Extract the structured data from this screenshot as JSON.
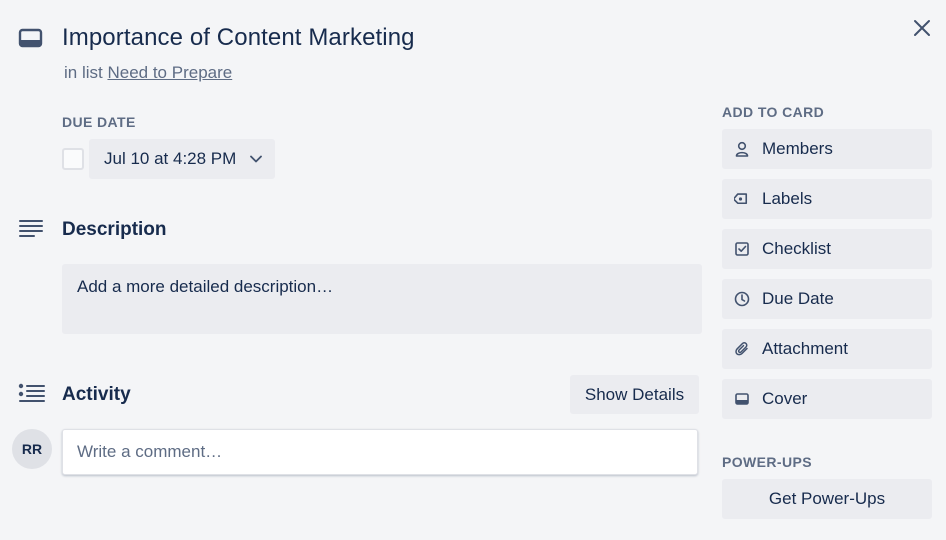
{
  "card": {
    "title": "Importance of Content Marketing",
    "list_prefix": "in list",
    "list_name": "Need to Prepare"
  },
  "due_date": {
    "label": "DUE DATE",
    "value": "Jul 10 at 4:28 PM",
    "checked": false
  },
  "description": {
    "heading": "Description",
    "placeholder": "Add a more detailed description…"
  },
  "activity": {
    "heading": "Activity",
    "show_details_label": "Show Details",
    "avatar_initials": "RR",
    "comment_placeholder": "Write a comment…"
  },
  "sidebar": {
    "add_to_card_label": "ADD TO CARD",
    "items": [
      {
        "label": "Members",
        "icon": "person-icon"
      },
      {
        "label": "Labels",
        "icon": "tag-icon"
      },
      {
        "label": "Checklist",
        "icon": "checkbox-icon"
      },
      {
        "label": "Due Date",
        "icon": "clock-icon"
      },
      {
        "label": "Attachment",
        "icon": "paperclip-icon"
      },
      {
        "label": "Cover",
        "icon": "cover-icon"
      }
    ],
    "power_ups_label": "POWER-UPS",
    "get_power_ups_label": "Get Power-Ups"
  },
  "colors": {
    "background": "#f4f5f7",
    "button": "#ebecf0",
    "text": "#172b4d",
    "subtle_text": "#5e6c84"
  }
}
